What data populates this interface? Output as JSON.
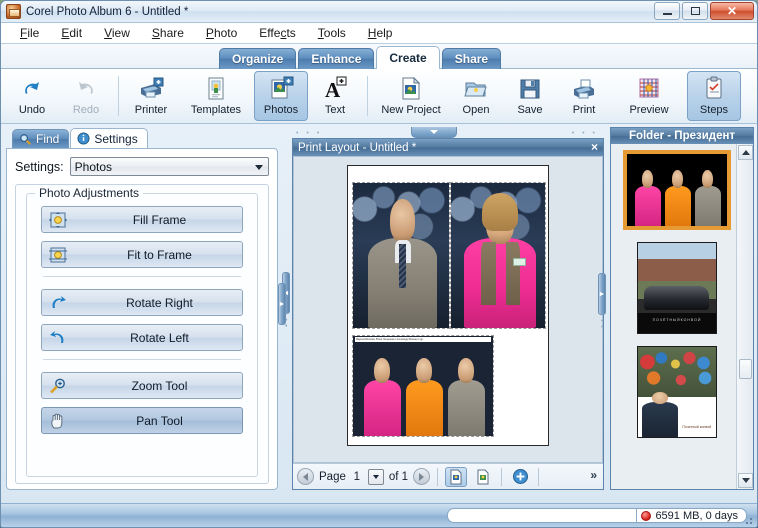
{
  "window": {
    "title": "Corel Photo Album 6 - Untitled *",
    "app_icon": "photo-album-icon",
    "minimize_label": "Minimize",
    "maximize_label": "Maximize",
    "close_label": "Close"
  },
  "menu": {
    "items": [
      {
        "label": "File",
        "accel": "F"
      },
      {
        "label": "Edit",
        "accel": "E"
      },
      {
        "label": "View",
        "accel": "V"
      },
      {
        "label": "Share",
        "accel": "S"
      },
      {
        "label": "Photo",
        "accel": "P"
      },
      {
        "label": "Effects",
        "accel": "c"
      },
      {
        "label": "Tools",
        "accel": "T"
      },
      {
        "label": "Help",
        "accel": "H"
      }
    ]
  },
  "main_tabs": [
    {
      "label": "Organize",
      "active": false
    },
    {
      "label": "Enhance",
      "active": false
    },
    {
      "label": "Create",
      "active": true
    },
    {
      "label": "Share",
      "active": false
    }
  ],
  "toolbar": {
    "items": [
      {
        "label": "Undo",
        "icon": "undo-arrow-icon",
        "state": "enabled"
      },
      {
        "label": "Redo",
        "icon": "redo-arrow-icon",
        "state": "disabled"
      },
      {
        "label": "Printer",
        "icon": "printer-add-icon",
        "state": "enabled"
      },
      {
        "label": "Templates",
        "icon": "template-page-icon",
        "state": "enabled"
      },
      {
        "label": "Photos",
        "icon": "photo-add-icon",
        "state": "selected"
      },
      {
        "label": "Text",
        "icon": "text-add-icon",
        "state": "enabled"
      },
      {
        "label": "New Project",
        "icon": "new-project-icon",
        "state": "enabled"
      },
      {
        "label": "Open",
        "icon": "open-folder-icon",
        "state": "enabled"
      },
      {
        "label": "Save",
        "icon": "save-floppy-icon",
        "state": "enabled"
      },
      {
        "label": "Print",
        "icon": "print-icon",
        "state": "enabled"
      },
      {
        "label": "Preview",
        "icon": "preview-grid-icon",
        "state": "enabled"
      },
      {
        "label": "Steps",
        "icon": "steps-clipboard-icon",
        "state": "selected"
      }
    ]
  },
  "left_panel": {
    "tabs": [
      {
        "label": "Find",
        "icon": "magnifier-icon",
        "active": false
      },
      {
        "label": "Settings",
        "icon": "info-icon",
        "active": true
      }
    ],
    "settings_label": "Settings:",
    "settings_value": "Photos",
    "settings_options": [
      "Photos"
    ],
    "group_title": "Photo Adjustments",
    "buttons": [
      {
        "label": "Fill Frame",
        "icon": "fill-frame-icon",
        "pressed": false
      },
      {
        "label": "Fit to Frame",
        "icon": "fit-to-frame-icon",
        "pressed": false
      },
      {
        "label": "Rotate Right",
        "icon": "rotate-right-icon",
        "pressed": false
      },
      {
        "label": "Rotate Left",
        "icon": "rotate-left-icon",
        "pressed": false
      },
      {
        "label": "Zoom Tool",
        "icon": "zoom-tool-icon",
        "pressed": false
      },
      {
        "label": "Pan Tool",
        "icon": "pan-hand-icon",
        "pressed": true
      }
    ]
  },
  "center_panel": {
    "title": "Print Layout - Untitled *",
    "close_label": "×",
    "page": {
      "prev_label": "previous-page",
      "label": "Page",
      "current": "1",
      "of_label": "of 1",
      "next_label": "next-page"
    },
    "bottom_buttons": [
      {
        "name": "add-page-button",
        "icon": "page-add-icon",
        "selected": true
      },
      {
        "name": "remove-page-button",
        "icon": "page-remove-icon",
        "selected": false
      },
      {
        "name": "zoom-in-button",
        "icon": "plus-circle-icon",
        "selected": false
      }
    ],
    "overflow_label": "»",
    "photos": [
      {
        "name": "photo-man-in-grey-jacket"
      },
      {
        "name": "photo-woman-in-pink-shirt"
      },
      {
        "name": "photo-audience-row-of-three"
      }
    ],
    "caption_text": "Марина Волкова, Юлия Латынина и Александр Минкин и др."
  },
  "right_panel": {
    "title": "Folder - Президент",
    "thumbnails": [
      {
        "name": "thumbnail-audience-selected",
        "selected": true
      },
      {
        "name": "thumbnail-car-poster",
        "selected": false,
        "caption": "П О Ч Ё Т Н Ы Й   К О Н В О Й"
      },
      {
        "name": "thumbnail-crowd-greeting",
        "selected": false,
        "caption": "Почетный\nконвой"
      }
    ],
    "scroll": {
      "up": "scroll-up",
      "down": "scroll-down"
    }
  },
  "status_bar": {
    "disk_text": "6591 MB, 0 days",
    "indicator": "red-disk-indicator"
  }
}
